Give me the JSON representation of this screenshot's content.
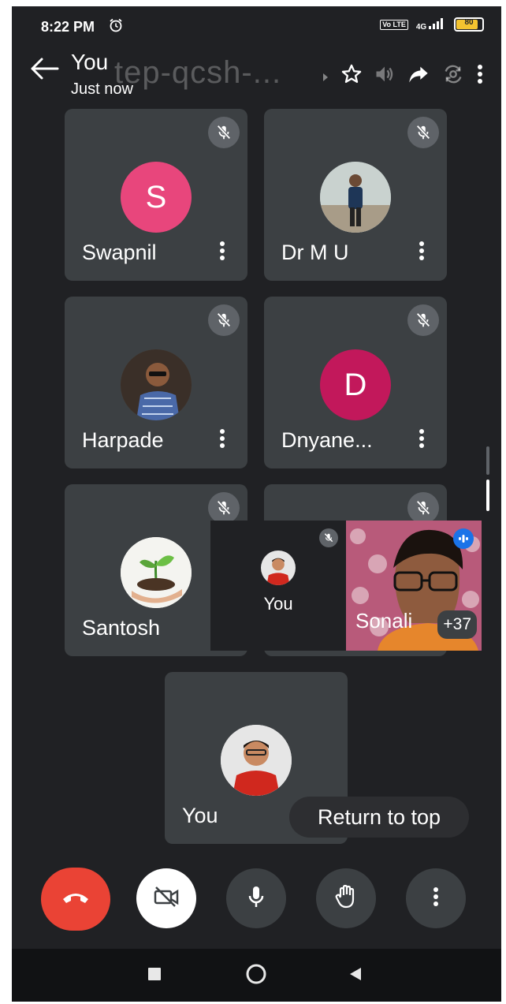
{
  "status_bar": {
    "time": "8:22 PM",
    "network": "4G",
    "volte": "Vo LTE",
    "battery": "80"
  },
  "meeting": {
    "title": "You",
    "subtitle": "Just now",
    "code": "tep-qcsh-..."
  },
  "icons": {
    "back": "arrow-left-icon",
    "star": "star-icon",
    "speaker": "volume-icon",
    "share": "share-arrow-icon",
    "switch_camera": "switch-camera-icon",
    "overflow": "more-vert-icon",
    "mic_off": "mic-off-icon",
    "end_call": "phone-hangup-icon",
    "camera_off": "video-off-icon",
    "mic": "mic-icon",
    "raise_hand": "hand-icon",
    "more": "more-vert-icon"
  },
  "participants": [
    {
      "name": "Swapnil",
      "initial": "S",
      "avatar_color": "#e8467c"
    },
    {
      "name": "Dr M U"
    },
    {
      "name": "Harpade"
    },
    {
      "name": "Dnyane...",
      "initial": "D",
      "avatar_color": "#c2185b"
    },
    {
      "name": "Santosh"
    }
  ],
  "self_tile": {
    "name": "You"
  },
  "pip": {
    "self_label": "You",
    "speaker_name": "Sonali",
    "extra_count": "+37"
  },
  "return_to_top": "Return to top",
  "colors": {
    "background": "#202124",
    "tile": "#3c4043",
    "end_call": "#ea4335",
    "accent_blue": "#1a73e8"
  }
}
